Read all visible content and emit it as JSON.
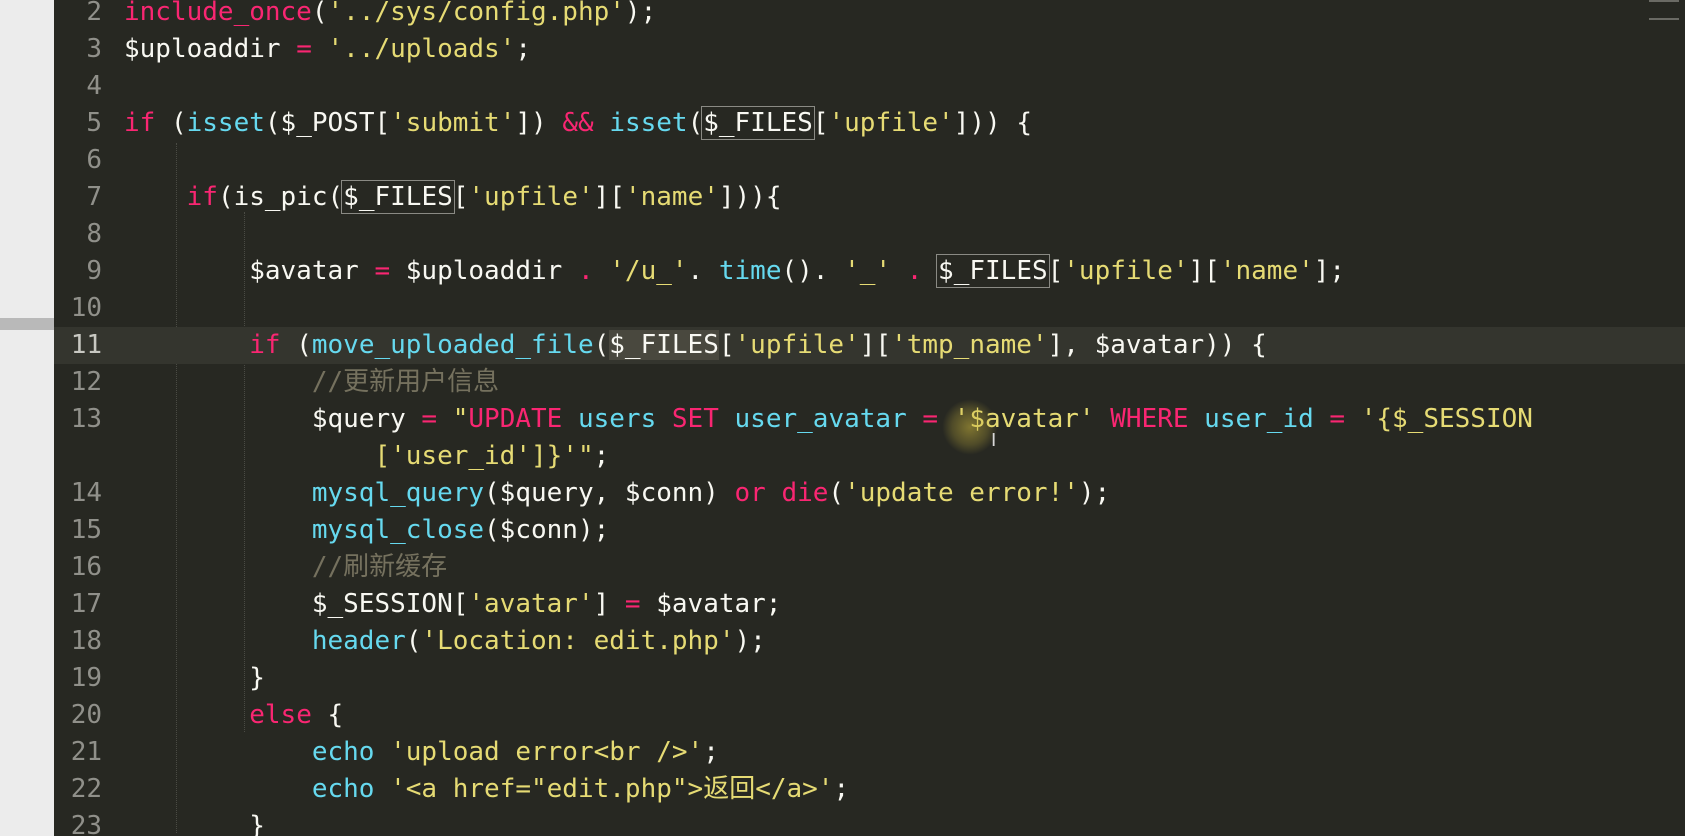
{
  "editor": {
    "language": "php",
    "theme_colors": {
      "background": "#272822",
      "text": "#f8f8f2",
      "keyword": "#f92672",
      "string": "#e6db74",
      "function": "#66d9ef",
      "comment": "#75715e",
      "line_number": "#90908a"
    },
    "active_line_number": "11",
    "lines": [
      {
        "num": "2",
        "tokens": [
          {
            "t": "include_once",
            "c": "k"
          },
          {
            "t": "(",
            "c": ""
          },
          {
            "t": "'../sys/config.php'",
            "c": "s"
          },
          {
            "t": ");",
            "c": ""
          }
        ]
      },
      {
        "num": "3",
        "tokens": [
          {
            "t": "$uploaddir ",
            "c": ""
          },
          {
            "t": "=",
            "c": "k"
          },
          {
            "t": " ",
            "c": ""
          },
          {
            "t": "'../uploads'",
            "c": "s"
          },
          {
            "t": ";",
            "c": ""
          }
        ]
      },
      {
        "num": "4",
        "tokens": []
      },
      {
        "num": "5",
        "tokens": [
          {
            "t": "if",
            "c": "k"
          },
          {
            "t": " (",
            "c": ""
          },
          {
            "t": "isset",
            "c": "f"
          },
          {
            "t": "($_POST[",
            "c": ""
          },
          {
            "t": "'submit'",
            "c": "s"
          },
          {
            "t": "]) ",
            "c": ""
          },
          {
            "t": "&&",
            "c": "k"
          },
          {
            "t": " ",
            "c": ""
          },
          {
            "t": "isset",
            "c": "f"
          },
          {
            "t": "(",
            "c": ""
          },
          {
            "t": "$_FILES",
            "c": "hl"
          },
          {
            "t": "[",
            "c": ""
          },
          {
            "t": "'upfile'",
            "c": "s"
          },
          {
            "t": "])) {",
            "c": ""
          }
        ]
      },
      {
        "num": "6",
        "tokens": []
      },
      {
        "num": "7",
        "tokens": [
          {
            "t": "    ",
            "c": ""
          },
          {
            "t": "if",
            "c": "k"
          },
          {
            "t": "(is_pic(",
            "c": ""
          },
          {
            "t": "$_FILES",
            "c": "hl"
          },
          {
            "t": "[",
            "c": ""
          },
          {
            "t": "'upfile'",
            "c": "s"
          },
          {
            "t": "][",
            "c": ""
          },
          {
            "t": "'name'",
            "c": "s"
          },
          {
            "t": "])){",
            "c": ""
          }
        ]
      },
      {
        "num": "8",
        "tokens": []
      },
      {
        "num": "9",
        "tokens": [
          {
            "t": "        $avatar ",
            "c": ""
          },
          {
            "t": "=",
            "c": "k"
          },
          {
            "t": " $uploaddir ",
            "c": ""
          },
          {
            "t": ".",
            "c": "k"
          },
          {
            "t": " ",
            "c": ""
          },
          {
            "t": "'/u_'",
            "c": "s"
          },
          {
            "t": ". ",
            "c": ""
          },
          {
            "t": "time",
            "c": "f"
          },
          {
            "t": "(). ",
            "c": ""
          },
          {
            "t": "'_'",
            "c": "s"
          },
          {
            "t": " ",
            "c": ""
          },
          {
            "t": ".",
            "c": "k"
          },
          {
            "t": " ",
            "c": ""
          },
          {
            "t": "$_FILES",
            "c": "hl"
          },
          {
            "t": "[",
            "c": ""
          },
          {
            "t": "'upfile'",
            "c": "s"
          },
          {
            "t": "][",
            "c": ""
          },
          {
            "t": "'name'",
            "c": "s"
          },
          {
            "t": "];",
            "c": ""
          }
        ]
      },
      {
        "num": "10",
        "tokens": []
      },
      {
        "num": "11",
        "tokens": [
          {
            "t": "        ",
            "c": ""
          },
          {
            "t": "if",
            "c": "k"
          },
          {
            "t": " (",
            "c": ""
          },
          {
            "t": "move_uploaded_file",
            "c": "f"
          },
          {
            "t": "(",
            "c": ""
          },
          {
            "t": "$_FILES",
            "c": "hl-sel"
          },
          {
            "t": "[",
            "c": ""
          },
          {
            "t": "'upfile'",
            "c": "s"
          },
          {
            "t": "][",
            "c": ""
          },
          {
            "t": "'tmp_name'",
            "c": "s"
          },
          {
            "t": "], $avatar)) {",
            "c": ""
          }
        ]
      },
      {
        "num": "12",
        "tokens": [
          {
            "t": "            ",
            "c": ""
          },
          {
            "t": "//更新用户信息",
            "c": "c"
          }
        ]
      },
      {
        "num": "13",
        "wrap": true,
        "tokens": [
          {
            "t": "            $query ",
            "c": ""
          },
          {
            "t": "=",
            "c": "k"
          },
          {
            "t": " ",
            "c": ""
          },
          {
            "t": "\"",
            "c": "s"
          },
          {
            "t": "UPDATE",
            "c": "k"
          },
          {
            "t": " ",
            "c": ""
          },
          {
            "t": "users",
            "c": "f"
          },
          {
            "t": " ",
            "c": ""
          },
          {
            "t": "SET",
            "c": "k"
          },
          {
            "t": " ",
            "c": ""
          },
          {
            "t": "user_avatar",
            "c": "f"
          },
          {
            "t": " ",
            "c": ""
          },
          {
            "t": "=",
            "c": "k"
          },
          {
            "t": " ",
            "c": ""
          },
          {
            "t": "'$avatar'",
            "c": "s"
          },
          {
            "t": " ",
            "c": ""
          },
          {
            "t": "WHERE",
            "c": "k"
          },
          {
            "t": " ",
            "c": ""
          },
          {
            "t": "user_id",
            "c": "f"
          },
          {
            "t": " ",
            "c": ""
          },
          {
            "t": "=",
            "c": "k"
          },
          {
            "t": " ",
            "c": ""
          },
          {
            "t": "'{$_SESSION",
            "c": "s"
          }
        ],
        "tokens2": [
          {
            "t": "                ",
            "c": ""
          },
          {
            "t": "['user_id']}'",
            "c": "s"
          },
          {
            "t": "\"",
            "c": "s"
          },
          {
            "t": ";",
            "c": ""
          }
        ]
      },
      {
        "num": "14",
        "tokens": [
          {
            "t": "            ",
            "c": ""
          },
          {
            "t": "mysql_query",
            "c": "f"
          },
          {
            "t": "($query, $conn) ",
            "c": ""
          },
          {
            "t": "or",
            "c": "k"
          },
          {
            "t": " ",
            "c": ""
          },
          {
            "t": "die",
            "c": "k"
          },
          {
            "t": "(",
            "c": ""
          },
          {
            "t": "'update error!'",
            "c": "s"
          },
          {
            "t": ");",
            "c": ""
          }
        ]
      },
      {
        "num": "15",
        "tokens": [
          {
            "t": "            ",
            "c": ""
          },
          {
            "t": "mysql_close",
            "c": "f"
          },
          {
            "t": "($conn);",
            "c": ""
          }
        ]
      },
      {
        "num": "16",
        "tokens": [
          {
            "t": "            ",
            "c": ""
          },
          {
            "t": "//刷新缓存",
            "c": "c"
          }
        ]
      },
      {
        "num": "17",
        "tokens": [
          {
            "t": "            $_SESSION[",
            "c": ""
          },
          {
            "t": "'avatar'",
            "c": "s"
          },
          {
            "t": "] ",
            "c": ""
          },
          {
            "t": "=",
            "c": "k"
          },
          {
            "t": " $avatar;",
            "c": ""
          }
        ]
      },
      {
        "num": "18",
        "tokens": [
          {
            "t": "            ",
            "c": ""
          },
          {
            "t": "header",
            "c": "f"
          },
          {
            "t": "(",
            "c": ""
          },
          {
            "t": "'Location: edit.php'",
            "c": "s"
          },
          {
            "t": ");",
            "c": ""
          }
        ]
      },
      {
        "num": "19",
        "tokens": [
          {
            "t": "        }",
            "c": ""
          }
        ]
      },
      {
        "num": "20",
        "tokens": [
          {
            "t": "        ",
            "c": ""
          },
          {
            "t": "else",
            "c": "k"
          },
          {
            "t": " {",
            "c": ""
          }
        ]
      },
      {
        "num": "21",
        "tokens": [
          {
            "t": "            ",
            "c": ""
          },
          {
            "t": "echo",
            "c": "f"
          },
          {
            "t": " ",
            "c": ""
          },
          {
            "t": "'upload error<br />'",
            "c": "s"
          },
          {
            "t": ";",
            "c": ""
          }
        ]
      },
      {
        "num": "22",
        "tokens": [
          {
            "t": "            ",
            "c": ""
          },
          {
            "t": "echo",
            "c": "f"
          },
          {
            "t": " ",
            "c": ""
          },
          {
            "t": "'<a href=\"edit.php\">返回</a>'",
            "c": "s"
          },
          {
            "t": ";",
            "c": ""
          }
        ]
      },
      {
        "num": "23",
        "tokens": [
          {
            "t": "        }",
            "c": ""
          }
        ]
      }
    ]
  }
}
